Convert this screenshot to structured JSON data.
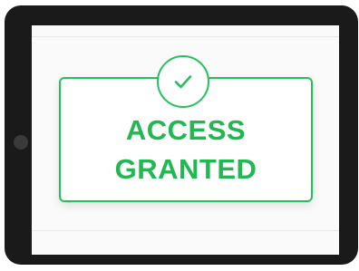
{
  "status": {
    "line1": "ACCESS",
    "line2": "GRANTED",
    "accent_color": "#22c25a",
    "icon": "check-icon"
  }
}
